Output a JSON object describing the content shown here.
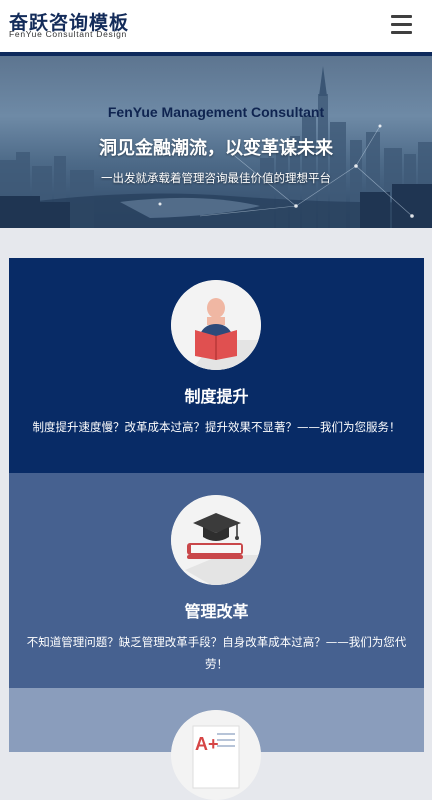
{
  "header": {
    "logo_title": "奋跃咨询模板",
    "logo_subtitle": "FenYue Consultant Design",
    "menu_icon": "hamburger-menu-icon"
  },
  "hero": {
    "title_en": "FenYue Management Consultant",
    "title_cn": "洞见金融潮流，以变革谋未来",
    "description": "一出发就承载着管理咨询最佳价值的理想平台"
  },
  "services": [
    {
      "title": "制度提升",
      "description": "制度提升速度慢？改革成本过高？提升效果不显著？——我们为您服务！",
      "icon": "reading-person-icon",
      "bg": "#082b66"
    },
    {
      "title": "管理改革",
      "description": "不知道管理问题？缺乏管理改革手段？自身改革成本过高？——我们为您代劳！",
      "icon": "graduation-cap-books-icon",
      "bg": "#466190"
    },
    {
      "title": "",
      "description": "",
      "icon": "grade-report-icon",
      "bg": "#8a9dbc"
    }
  ],
  "colors": {
    "brand": "#142c5a",
    "header_line": "#0e2a5c",
    "page_bg": "#e6e8ed"
  }
}
